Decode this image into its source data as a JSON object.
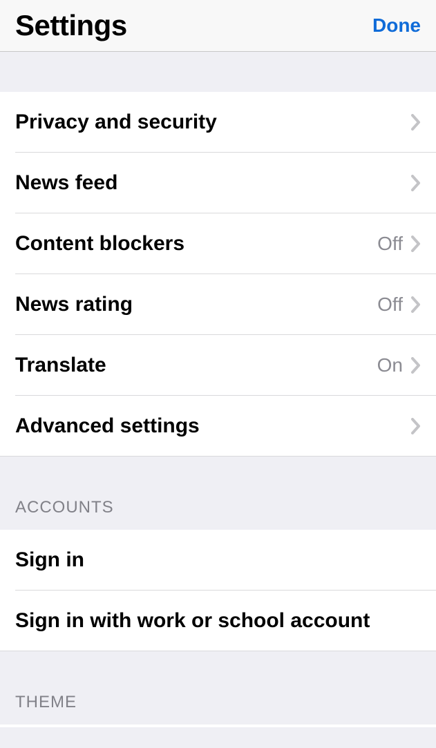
{
  "header": {
    "title": "Settings",
    "done_label": "Done"
  },
  "sections": {
    "main": {
      "items": [
        {
          "label": "Privacy and security",
          "value": null
        },
        {
          "label": "News feed",
          "value": null
        },
        {
          "label": "Content blockers",
          "value": "Off"
        },
        {
          "label": "News rating",
          "value": "Off"
        },
        {
          "label": "Translate",
          "value": "On"
        },
        {
          "label": "Advanced settings",
          "value": null
        }
      ]
    },
    "accounts": {
      "header": "ACCOUNTS",
      "items": [
        {
          "label": "Sign in"
        },
        {
          "label": "Sign in with work or school account"
        }
      ]
    },
    "theme": {
      "header": "THEME"
    }
  }
}
